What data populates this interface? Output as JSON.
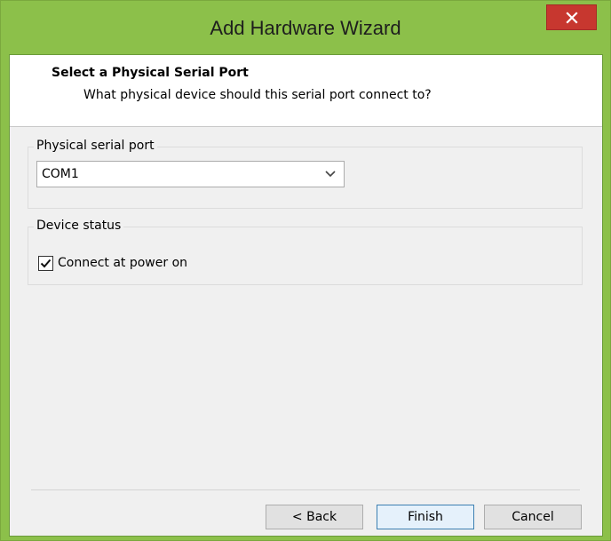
{
  "window": {
    "title": "Add Hardware Wizard",
    "close_glyph": "✕"
  },
  "header": {
    "title": "Select a Physical Serial Port",
    "subtitle": "What physical device should this serial port connect to?"
  },
  "serial_port_group": {
    "legend": "Physical serial port",
    "selected_value": "COM1"
  },
  "device_status_group": {
    "legend": "Device status",
    "connect_at_power_on": {
      "label": "Connect at power on",
      "checked": true
    }
  },
  "buttons": {
    "back": "< Back",
    "finish": "Finish",
    "cancel": "Cancel"
  },
  "colors": {
    "window_frame": "#8cc04a",
    "close_button": "#c7372f",
    "client_bg": "#f0f0f0",
    "default_button_border": "#3c7fb1"
  },
  "icons": {
    "close": "close-icon",
    "dropdown": "chevron-down-icon",
    "checkbox": "checkmark-icon"
  }
}
